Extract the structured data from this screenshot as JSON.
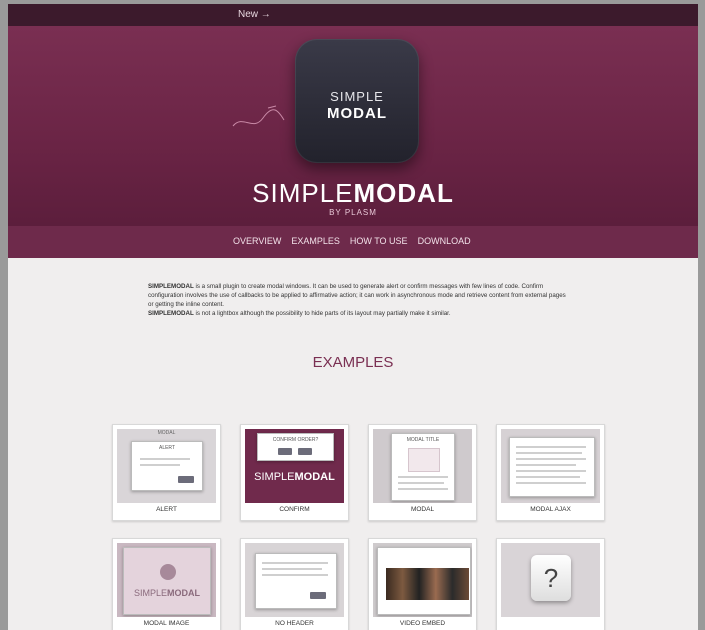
{
  "topbar": {
    "new_link": "New →"
  },
  "hero": {
    "icon_line1": "SIMPLE",
    "icon_line2": "MODAL",
    "brand_light": "SIMPLE",
    "brand_bold": "MODAL",
    "byline": "BY PLASM"
  },
  "nav": {
    "items": [
      "OVERVIEW",
      "EXAMPLES",
      "HOW TO USE",
      "DOWNLOAD"
    ]
  },
  "intro": {
    "p1_name": "SIMPLEMODAL",
    "p1_text": " is a small plugin to create modal windows. It can be used to generate alert or confirm messages with few lines of code. Confirm configuration involves the use of callbacks to be applied to affirmative action; it can work in asynchronous mode and retrieve content from external pages or getting the inline content.",
    "p2_name": "SIMPLEMODAL",
    "p2_text": " is not a lightbox although the possibility to hide parts of its layout may partially make it similar."
  },
  "examples": {
    "title": "EXAMPLES",
    "items": [
      {
        "label": "ALERT"
      },
      {
        "label": "CONFIRM"
      },
      {
        "label": "MODAL"
      },
      {
        "label": "MODAL AJAX"
      },
      {
        "label": "MODAL IMAGE"
      },
      {
        "label": "NO HEADER"
      },
      {
        "label": "VIDEO EMBED"
      },
      {
        "label": ""
      }
    ],
    "thumb_texts": {
      "modal_header": "MODAL",
      "alert_header": "ALERT",
      "confirm_header": "CONFIRM ORDER?",
      "modal_title": "MODAL TITLE",
      "simple_light": "SIMPLE",
      "simple_bold": "MODAL",
      "question": "?"
    }
  },
  "colors": {
    "brand_purple": "#702a4c",
    "topbar": "#3c1a2c"
  }
}
